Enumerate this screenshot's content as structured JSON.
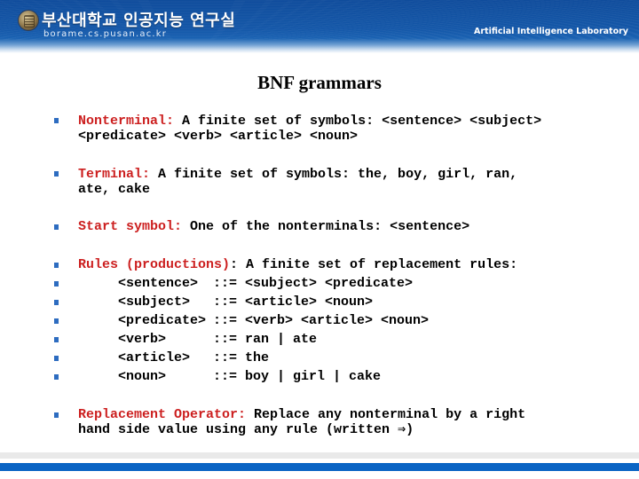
{
  "header": {
    "lab_name_korean": "부산대학교 인공지능 연구실",
    "lab_url": "borame.cs.pusan.ac.kr",
    "lab_name_english": "Artificial Intelligence Laboratory",
    "logo_icon": "university-seal-icon",
    "colors": {
      "banner": "#1457a8",
      "footer_bar": "#0a64c4",
      "footer_gray": "#e9e9e9"
    }
  },
  "slide": {
    "title": "BNF grammars",
    "accent_color": "#cc1f1f",
    "bullet_color": "#2d6cc0",
    "bullets": [
      {
        "keyword": "Nonterminal:",
        "line1": " A finite set of symbols: <sentence> <subject>",
        "line2": "<predicate> <verb> <article> <noun>"
      },
      {
        "keyword": "Terminal:",
        "line1": " A finite set of symbols: the, boy, girl, ran,",
        "line2": "ate, cake"
      },
      {
        "keyword": "Start symbol:",
        "line1": " One of the nonterminals: <sentence>"
      },
      {
        "keyword": "Rules (productions)",
        "line1": ": A finite set of replacement rules:"
      },
      {
        "keyword": "Replacement Operator:",
        "line1": " Replace any nonterminal by a right",
        "line2": "hand side value using any rule (written ⇒)"
      }
    ],
    "rules": [
      {
        "lhs": "<sentence>",
        "op": "::=",
        "rhs": "<subject> <predicate>"
      },
      {
        "lhs": "<subject>",
        "op": "::=",
        "rhs": "<article> <noun>"
      },
      {
        "lhs": "<predicate>",
        "op": "::=",
        "rhs": "<verb> <article> <noun>"
      },
      {
        "lhs": "<verb>",
        "op": "::=",
        "rhs": "ran | ate"
      },
      {
        "lhs": "<article>",
        "op": "::=",
        "rhs": "the"
      },
      {
        "lhs": "<noun>",
        "op": "::=",
        "rhs": "boy | girl | cake"
      }
    ]
  }
}
